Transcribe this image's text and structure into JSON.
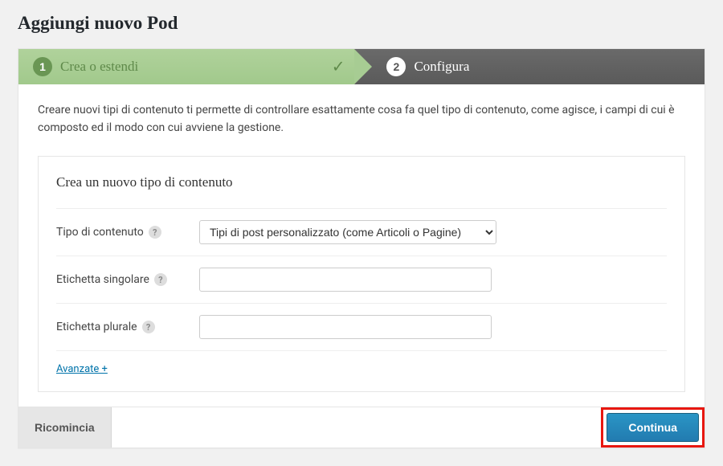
{
  "page": {
    "title": "Aggiungi nuovo Pod"
  },
  "steps": {
    "s1": {
      "num": "1",
      "label": "Crea o estendi"
    },
    "s2": {
      "num": "2",
      "label": "Configura"
    }
  },
  "intro": "Creare nuovi tipi di contenuto ti permette di controllare esattamente cosa fa quel tipo di contenuto, come agisce, i campi di cui è composto ed il modo con cui avviene la gestione.",
  "form": {
    "heading": "Crea un nuovo tipo di contenuto",
    "content_type": {
      "label": "Tipo di contenuto",
      "selected": "Tipi di post personalizzato (come Articoli o Pagine)"
    },
    "singular": {
      "label": "Etichetta singolare",
      "value": ""
    },
    "plural": {
      "label": "Etichetta plurale",
      "value": ""
    },
    "advanced": "Avanzate +"
  },
  "footer": {
    "restart": "Ricomincia",
    "continue": "Continua"
  },
  "help_glyph": "?"
}
